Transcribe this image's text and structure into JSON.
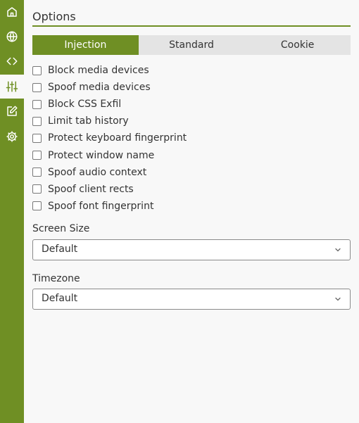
{
  "sidebar": {
    "items": [
      {
        "name": "home-icon",
        "active": false
      },
      {
        "name": "globe-icon",
        "active": false
      },
      {
        "name": "code-icon",
        "active": false
      },
      {
        "name": "sliders-icon",
        "active": true
      },
      {
        "name": "edit-icon",
        "active": false
      },
      {
        "name": "gear-icon",
        "active": false
      }
    ]
  },
  "main": {
    "title": "Options",
    "tabs": [
      {
        "label": "Injection",
        "active": true
      },
      {
        "label": "Standard",
        "active": false
      },
      {
        "label": "Cookie",
        "active": false
      }
    ],
    "options": [
      {
        "label": "Block media devices",
        "checked": false
      },
      {
        "label": "Spoof media devices",
        "checked": false
      },
      {
        "label": "Block CSS Exfil",
        "checked": false
      },
      {
        "label": "Limit tab history",
        "checked": false
      },
      {
        "label": "Protect keyboard fingerprint",
        "checked": false
      },
      {
        "label": "Protect window name",
        "checked": false
      },
      {
        "label": "Spoof audio context",
        "checked": false
      },
      {
        "label": "Spoof client rects",
        "checked": false
      },
      {
        "label": "Spoof font fingerprint",
        "checked": false
      }
    ],
    "screen_size": {
      "label": "Screen Size",
      "value": "Default"
    },
    "timezone": {
      "label": "Timezone",
      "value": "Default"
    }
  },
  "colors": {
    "accent": "#6f8f24",
    "tab_bg": "#e4e4e4",
    "page_bg": "#f8f8f8"
  }
}
